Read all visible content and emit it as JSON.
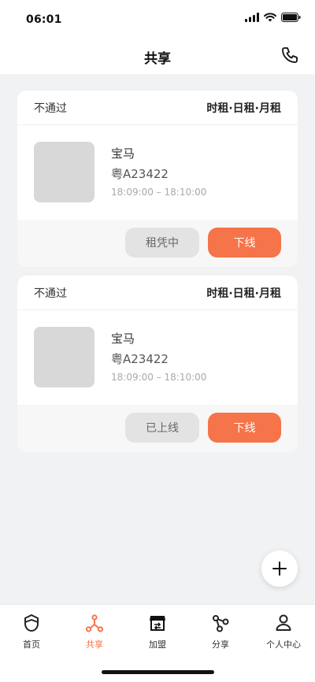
{
  "status_bar": {
    "time": "06:01"
  },
  "header": {
    "title": "共享"
  },
  "cards": [
    {
      "status": "不通过",
      "plans": "时租·日租·月租",
      "car_name": "宝马",
      "plate": "粤A23422",
      "time_range": "18:09:00 – 18:10:00",
      "secondary_button": "租凭中",
      "primary_button": "下线"
    },
    {
      "status": "不通过",
      "plans": "时租·日租·月租",
      "car_name": "宝马",
      "plate": "粤A23422",
      "time_range": "18:09:00 – 18:10:00",
      "secondary_button": "已上线",
      "primary_button": "下线"
    }
  ],
  "fab": {
    "icon": "plus-icon"
  },
  "tabbar": {
    "items": [
      {
        "label": "首页",
        "icon": "home-shield-icon",
        "active": false
      },
      {
        "label": "共享",
        "icon": "share-nodes-icon",
        "active": true
      },
      {
        "label": "加盟",
        "icon": "store-icon",
        "active": false
      },
      {
        "label": "分享",
        "icon": "share-icon",
        "active": false
      },
      {
        "label": "个人中心",
        "icon": "user-icon",
        "active": false
      }
    ]
  },
  "colors": {
    "accent": "#f6744a",
    "background": "#f1f2f4",
    "placeholder": "#d8d8d8"
  }
}
